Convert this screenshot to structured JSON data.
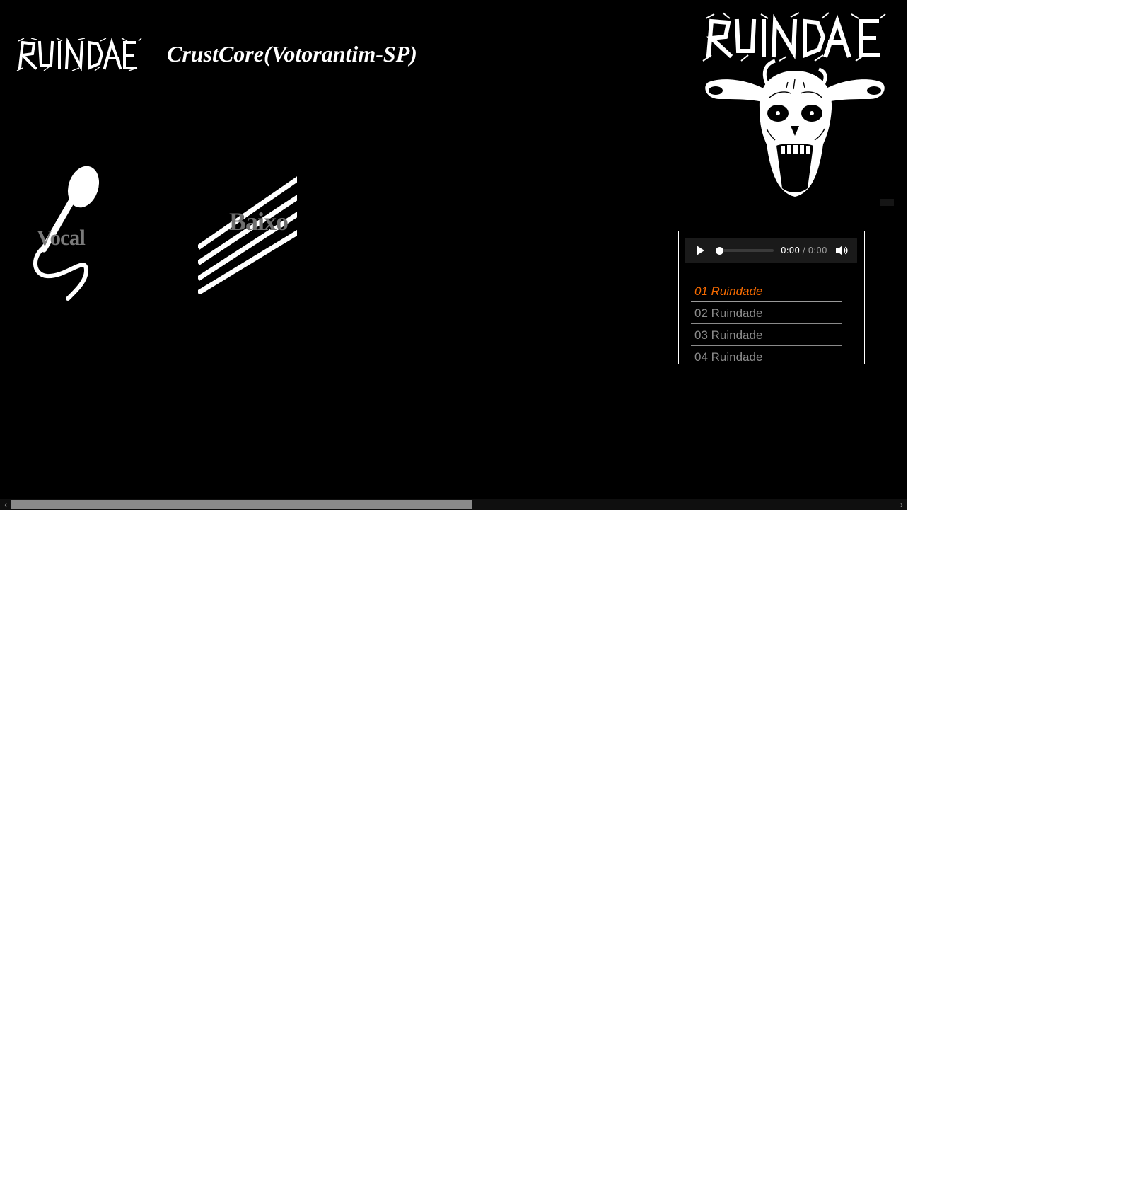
{
  "header": {
    "logo_text": "RUINDADE",
    "title": "CrustCore(Votorantim-SP)"
  },
  "members": {
    "vocal_label": "Vocal",
    "bass_label": "Baixo"
  },
  "player": {
    "current_time": "0:00",
    "separator": " / ",
    "duration": "0:00",
    "progress_fraction": 0,
    "tracks": [
      {
        "title": "01 Ruindade",
        "active": true
      },
      {
        "title": "02 Ruindade",
        "active": false
      },
      {
        "title": "03 Ruindade",
        "active": false
      },
      {
        "title": "04 Ruindade",
        "active": false
      }
    ]
  },
  "colors": {
    "background": "#000000",
    "accent_active_track": "#f56a00",
    "track_text": "#8c8c8c"
  },
  "scrollbar": {
    "left_arrow": "‹",
    "right_arrow": "›"
  }
}
